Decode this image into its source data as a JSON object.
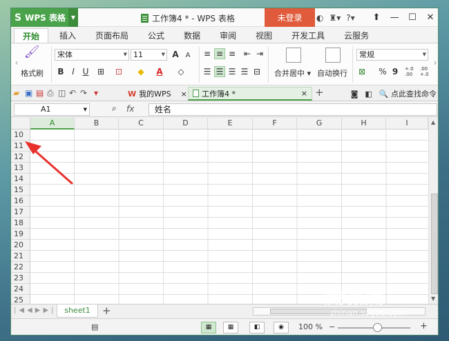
{
  "titlebar": {
    "app_name": "WPS 表格",
    "window_title": "工作簿4 * - WPS 表格",
    "login_label": "未登录",
    "help_label": "?"
  },
  "menu": {
    "tabs": [
      "开始",
      "插入",
      "页面布局",
      "公式",
      "数据",
      "审阅",
      "视图",
      "开发工具",
      "云服务"
    ]
  },
  "ribbon": {
    "format_painter_label": "格式刷",
    "font_name": "宋体",
    "font_size": "11",
    "merge_center_label": "合并居中",
    "wrap_text_label": "自动换行",
    "number_format": "常规",
    "percent_label": "%",
    "comma_label": "9",
    "inc_decimal_label": "+.0 .00",
    "dec_decimal_label": ".00 +.0",
    "bold_label": "B",
    "italic_label": "I",
    "underline_label": "U",
    "font_grow_label": "A",
    "font_shrink_label": "A",
    "font_color_label": "A"
  },
  "quickbar": {
    "doc_tabs": [
      {
        "label": "我的WPS",
        "close": "×"
      },
      {
        "label": "工作簿4 *",
        "close": "×"
      }
    ],
    "new_tab": "+",
    "search_label": "点此查找命令"
  },
  "formula_bar": {
    "name_box": "A1",
    "fx_label": "fx",
    "content": "姓名"
  },
  "grid": {
    "columns": [
      "A",
      "B",
      "C",
      "D",
      "E",
      "F",
      "G",
      "H",
      "I"
    ],
    "selected_column": "A",
    "rows": [
      "10",
      "11",
      "12",
      "13",
      "14",
      "15",
      "16",
      "17",
      "18",
      "19",
      "20",
      "21",
      "22",
      "23",
      "24",
      "25"
    ]
  },
  "sheets": {
    "tabs": [
      "sheet1"
    ],
    "add": "+"
  },
  "status": {
    "zoom": "100 %",
    "zoom_minus": "−",
    "zoom_plus": "+"
  },
  "watermark": {
    "text": "搜狗指南",
    "url": "zhinan.sogou.com"
  },
  "colors": {
    "accent": "#4aa34a",
    "login": "#e05b3c",
    "arrow": "#e8302c"
  }
}
